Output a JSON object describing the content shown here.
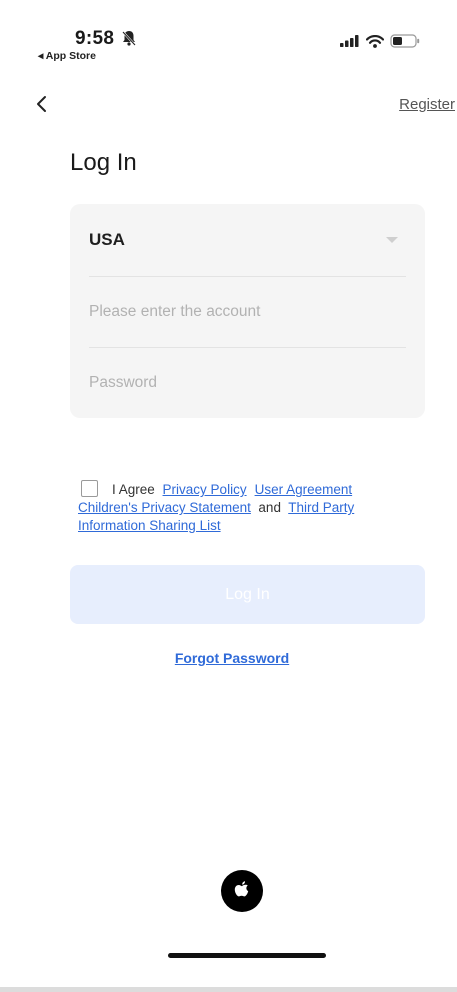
{
  "status_bar": {
    "time": "9:58",
    "back_app": "◂ App Store",
    "icons": [
      "bell-muted-icon",
      "signal-icon",
      "wifi-icon",
      "battery-icon"
    ]
  },
  "nav": {
    "back_icon": "chevron-left-icon",
    "register_label": "Register"
  },
  "page": {
    "title": "Log In"
  },
  "form": {
    "region_value": "USA",
    "account_placeholder": "Please enter the account",
    "account_value": "",
    "password_placeholder": "Password",
    "password_value": ""
  },
  "agreement": {
    "checked": false,
    "prefix": "I Agree",
    "privacy_policy": "Privacy Policy",
    "user_agreement": "User Agreement",
    "children_privacy": "Children's Privacy Statement",
    "and": "and",
    "third_party": "Third Party Information Sharing List"
  },
  "actions": {
    "login_label": "Log In",
    "forgot_label": "Forgot Password"
  },
  "social": {
    "apple_icon": "apple-icon"
  },
  "colors": {
    "link": "#2f6ad8",
    "login_disabled_bg": "#e7eefd",
    "card_bg": "#f5f5f5"
  }
}
